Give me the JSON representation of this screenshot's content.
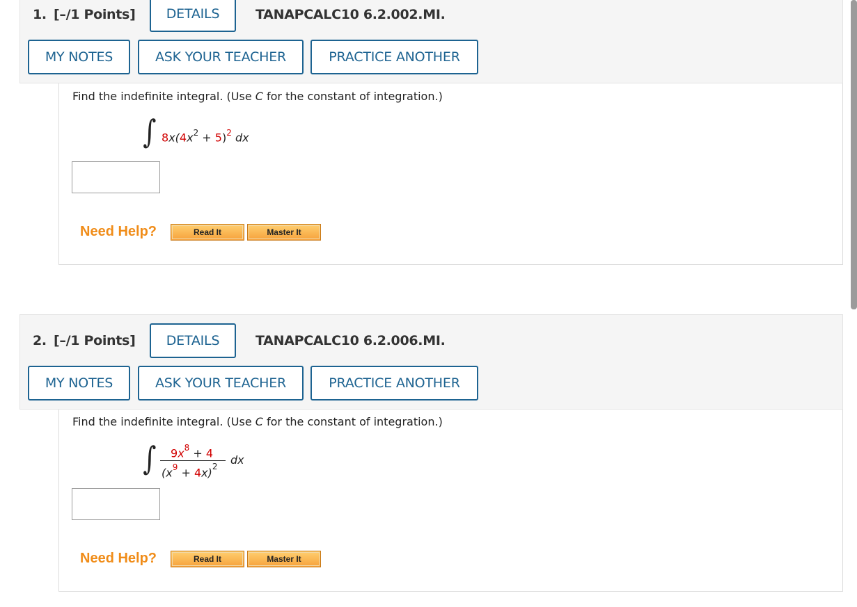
{
  "questions": [
    {
      "number": "1.",
      "points": "[–/1 Points]",
      "details_label": "DETAILS",
      "code": "TANAPCALC10 6.2.002.MI.",
      "my_notes": "MY NOTES",
      "ask_teacher": "ASK YOUR TEACHER",
      "practice": "PRACTICE ANOTHER",
      "instruction_pre": "Find the indefinite integral. (Use ",
      "instruction_c": "C",
      "instruction_post": " for the constant of integration.)",
      "expr": {
        "a": "8",
        "b": "x(",
        "c": "4",
        "d": "x",
        "e": "2",
        "f": " + ",
        "g": "5",
        "h": ")",
        "i": "2",
        "j": " dx"
      },
      "answer_value": "",
      "need_help": "Need Help?",
      "read_it": "Read It",
      "master_it": "Master It"
    },
    {
      "number": "2.",
      "points": "[–/1 Points]",
      "details_label": "DETAILS",
      "code": "TANAPCALC10 6.2.006.MI.",
      "my_notes": "MY NOTES",
      "ask_teacher": "ASK YOUR TEACHER",
      "practice": "PRACTICE ANOTHER",
      "instruction_pre": "Find the indefinite integral. (Use ",
      "instruction_c": "C",
      "instruction_post": " for the constant of integration.)",
      "frac": {
        "n1": "9",
        "n2": "x",
        "n3": "8",
        "n4": " + ",
        "n5": "4",
        "d1": "(x",
        "d2": "9",
        "d3": " + ",
        "d4": "4",
        "d5": "x)",
        "d6": "2",
        "dx": "dx"
      },
      "answer_value": "",
      "need_help": "Need Help?",
      "read_it": "Read It",
      "master_it": "Master It"
    }
  ],
  "colors": {
    "accent": "#1d6391",
    "red": "#d10000",
    "help_orange": "#f08c18"
  }
}
